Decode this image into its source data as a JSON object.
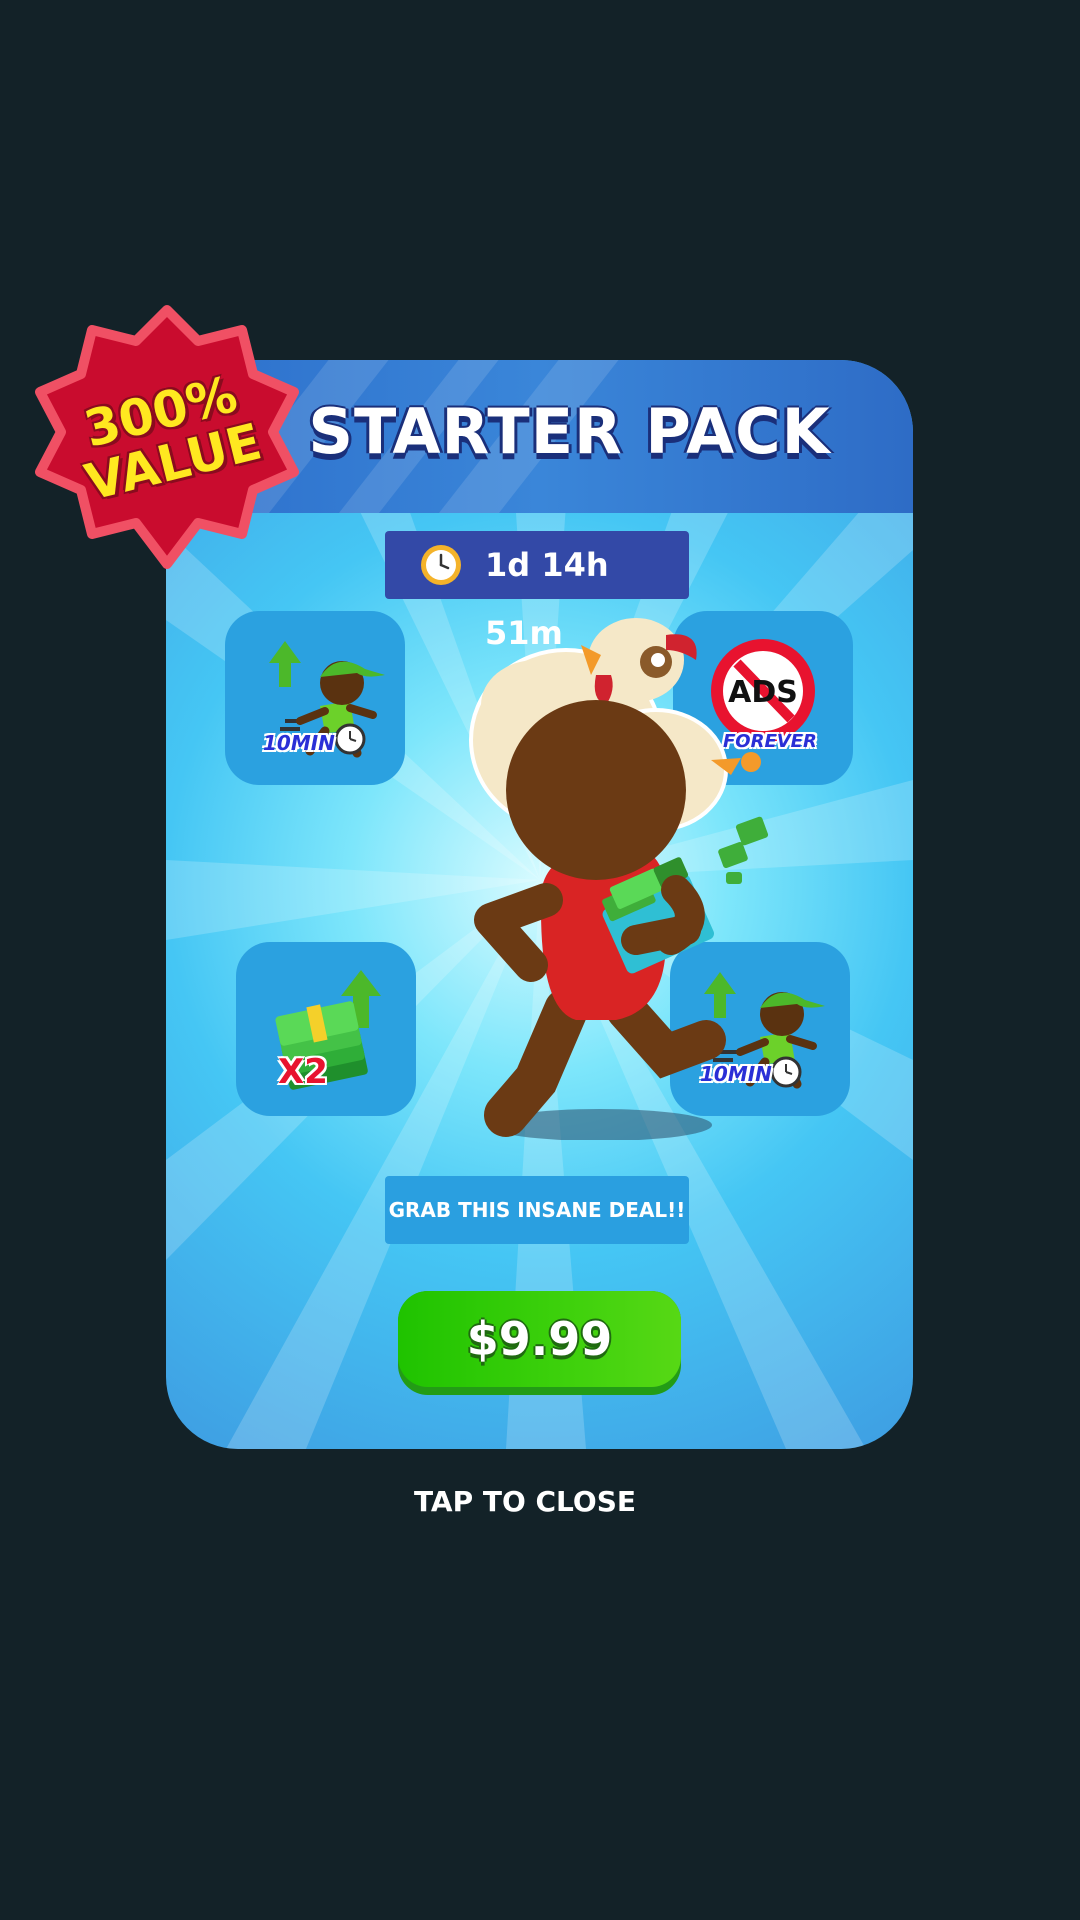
{
  "offer": {
    "title": "STARTER PACK",
    "timer": "1d 14h 51m",
    "deal_text": "GRAB THIS INSANE DEAL!!",
    "price": "$9.99",
    "badge": {
      "line1": "300%",
      "line2": "VALUE"
    },
    "rewards": [
      {
        "icon": "speed-boost-runner-icon",
        "label": "10MIN"
      },
      {
        "icon": "no-ads-icon",
        "text": "ADS",
        "label": "FOREVER"
      },
      {
        "icon": "double-cash-icon",
        "label": "X2"
      },
      {
        "icon": "speed-boost-runner-icon",
        "label": "10MIN"
      }
    ]
  },
  "footer": {
    "close_label": "TAP TO CLOSE"
  },
  "colors": {
    "background": "#132228",
    "card_header": "#2e6cc6",
    "timer_bg": "#3349a7",
    "tile_bg": "#2ba1e0",
    "buy_button": "#3ed10c",
    "badge": "#cc0a2f",
    "badge_text": "#ffe820"
  }
}
